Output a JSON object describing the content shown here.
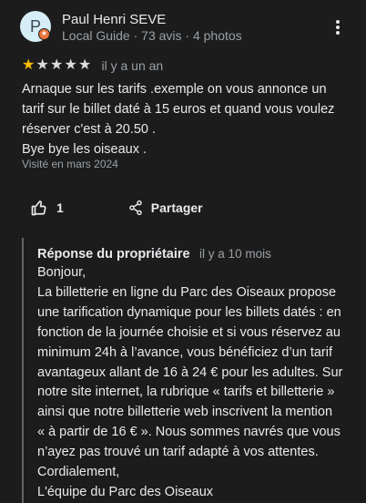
{
  "reviewer": {
    "initial": "P",
    "badge_icon": "local-guide-badge-icon",
    "name": "Paul Henri SEVE",
    "meta": "Local Guide · 73 avis · 4 photos"
  },
  "review": {
    "rating": 1,
    "max_rating": 5,
    "date": "il y a un an",
    "text_lines": [
      "Arnaque sur les tarifs .exemple on vous annonce un",
      "tarif sur le billet daté à 15 euros et quand vous voulez",
      "réserver c'est à 20.50 .",
      "Bye bye les oiseaux ."
    ],
    "visited": "Visité en mars 2024"
  },
  "actions": {
    "like_icon": "thumbs-up-icon",
    "like_count": "1",
    "share_icon": "share-icon",
    "share_label": "Partager"
  },
  "owner_reply": {
    "title": "Réponse du propriétaire",
    "date": "il y a 10 mois",
    "text_lines": [
      "Bonjour,",
      "La billetterie en ligne du Parc des Oiseaux propose",
      "une tarification dynamique pour les billets datés : en",
      "fonction de la journée choisie et si vous réservez au",
      "minimum 24h à l’avance, vous bénéficiez d’un tarif",
      "avantageux allant de 16 à 24 € pour les adultes. Sur",
      "notre site internet, la rubrique « tarifs et billetterie »",
      "ainsi que notre billetterie web inscrivent la mention",
      "« à partir de 16 € ». Nous sommes navrés que vous",
      "n’ayez pas trouvé un tarif adapté à vos attentes.",
      "Cordialement,",
      "L'équipe du Parc des Oiseaux"
    ]
  },
  "colors": {
    "background": "#1c1c1c",
    "star_filled": "#fbbc04",
    "star_empty": "#dadce0",
    "secondary_text": "#9aa0a6"
  }
}
